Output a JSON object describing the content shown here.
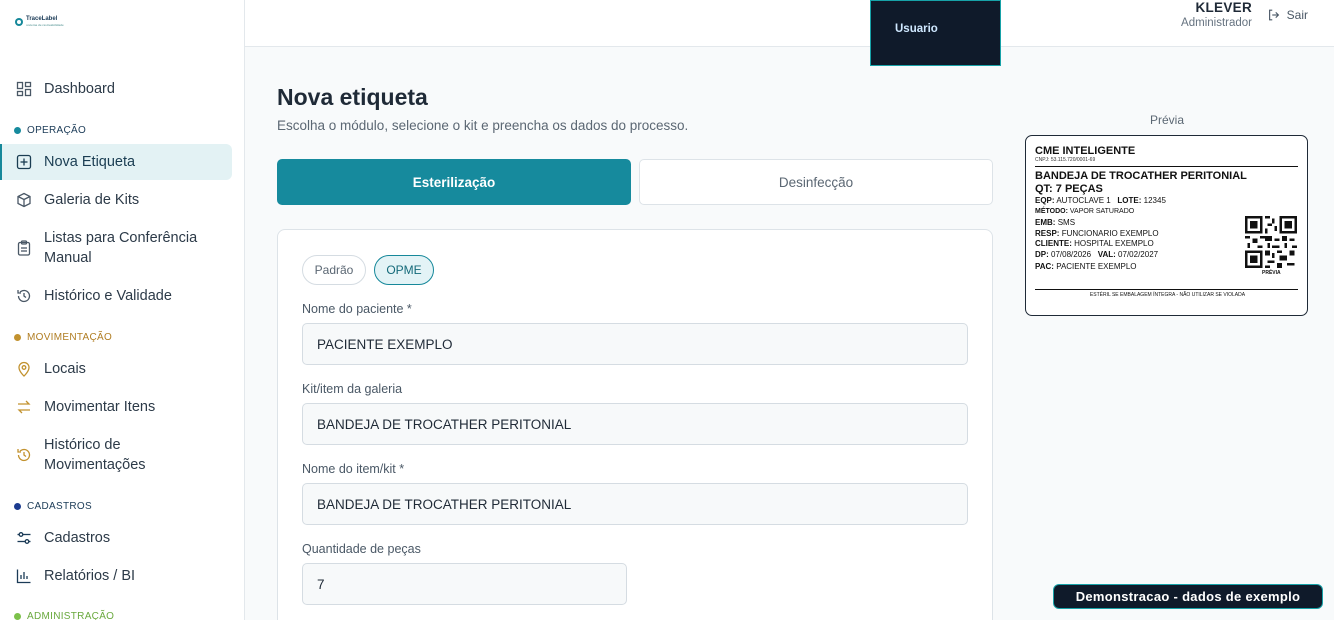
{
  "brand": {
    "name": "TraceLabel",
    "tag": "sistema de rastreabilidade",
    "accent": "#168a9d"
  },
  "sidebar": {
    "items": {
      "dashboard": "Dashboard",
      "nova_etiqueta": "Nova Etiqueta",
      "galeria_kits": "Galeria de Kits",
      "listas_1": "Listas para Conferência",
      "listas_2": "Manual",
      "historico_validade": "Histórico e Validade",
      "locais": "Locais",
      "movimentar": "Movimentar Itens",
      "hist_mov_1": "Histórico de",
      "hist_mov_2": "Movimentações",
      "cadastros": "Cadastros",
      "relatorios": "Relatórios / BI"
    },
    "sections": {
      "operacao": "OPERAÇÃO",
      "movimentacao": "MOVIMENTAÇÃO",
      "cadastros": "CADASTROS",
      "administracao": "ADMINISTRAÇÃO"
    },
    "section_colors": {
      "operacao": "#168a9d",
      "movimentacao": "#c2922f",
      "cadastros": "#1b3b8f",
      "administracao": "#7cc14a"
    }
  },
  "topbar": {
    "tooltip": "Usuario",
    "user_name": "KLEVER",
    "user_role": "Administrador",
    "logout": "Sair"
  },
  "main": {
    "title": "Nova etiqueta",
    "subtitle": "Escolha o módulo, selecione o kit e preencha os dados do processo.",
    "tabs": [
      "Esterilização",
      "Desinfecção"
    ],
    "pills": [
      "Padrão",
      "OPME"
    ],
    "fields": {
      "paciente_label": "Nome do paciente *",
      "paciente_value": "PACIENTE EXEMPLO",
      "kit_label": "Kit/item da galeria",
      "kit_value": "BANDEJA DE TROCATHER PERITONIAL",
      "item_label": "Nome do item/kit *",
      "item_value": "BANDEJA DE TROCATHER PERITONIAL",
      "qtd_label": "Quantidade de peças",
      "qtd_value": "7"
    }
  },
  "preview": {
    "title": "Prévia",
    "header": "CME INTELIGENTE",
    "cnpj": "CNPJ: 53.115.720/0001-69",
    "kit": "BANDEJA DE TROCATHER PERITONIAL",
    "qt": "QT: 7 PEÇAS",
    "eqp_k": "EQP:",
    "eqp_v": "AUTOCLAVE 1",
    "lote_k": "LOTE:",
    "lote_v": "12345",
    "metodo_k": "MÉTODO:",
    "metodo_v": "VAPOR SATURADO",
    "emb_k": "EMB:",
    "emb_v": "SMS",
    "resp_k": "RESP:",
    "resp_v": "FUNCIONARIO EXEMPLO",
    "cliente_k": "CLIENTE:",
    "cliente_v": "HOSPITAL EXEMPLO",
    "dp_k": "DP:",
    "dp_v": "07/08/2026",
    "val_k": "VAL:",
    "val_v": "07/02/2027",
    "pac_k": "PAC:",
    "pac_v": "PACIENTE EXEMPLO",
    "qr_caption": "PRÉVIA",
    "footer": "ESTÉRIL SE EMBALAGEM ÍNTEGRA - NÃO UTILIZAR SE VIOLADA"
  },
  "demo_badge": "Demonstracao - dados de exemplo"
}
